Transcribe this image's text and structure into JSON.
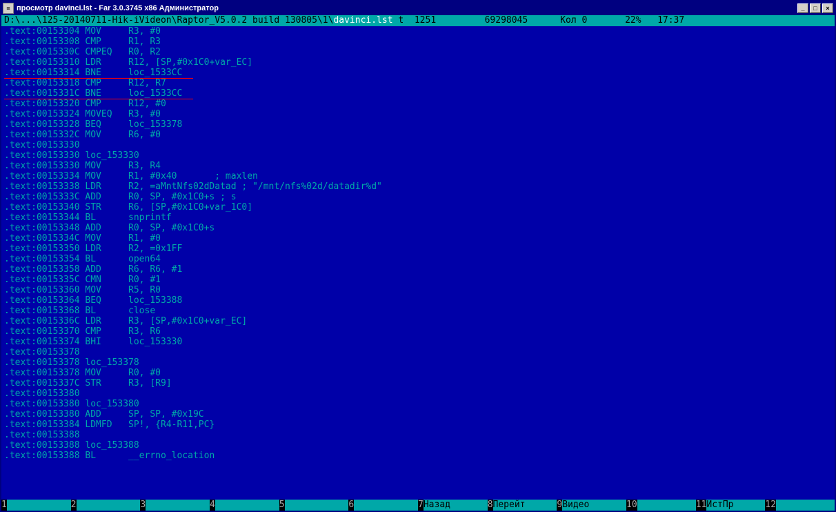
{
  "window": {
    "title": "просмотр davinci.lst - Far 3.0.3745 x86 Администратор"
  },
  "status": {
    "path_prefix": "D:\\...\\125-20140711-Hik-iVideon\\Raptor_V5.0.2 build 130805\\1\\",
    "filename": "davinci.lst",
    "mode": "t",
    "codepage": "1251",
    "size": "69298045",
    "col": "Кол 0",
    "percent": "22%",
    "time": "17:37"
  },
  "code": [
    {
      "addr": ".text:00153304",
      "m": "MOV",
      "o": "R3, #0"
    },
    {
      "addr": ".text:00153308",
      "m": "CMP",
      "o": "R1, R3"
    },
    {
      "addr": ".text:0015330C",
      "m": "CMPEQ",
      "o": "R0, R2"
    },
    {
      "addr": ".text:00153310",
      "m": "LDR",
      "o": "R12, [SP,#0x1C0+var_EC]"
    },
    {
      "addr": ".text:00153314",
      "m": "BNE",
      "o": "loc_1533CC",
      "u": true
    },
    {
      "addr": ".text:00153318",
      "m": "CMP",
      "o": "R12, R7"
    },
    {
      "addr": ".text:0015331C",
      "m": "BNE",
      "o": "loc_1533CC",
      "u": true
    },
    {
      "addr": ".text:00153320",
      "m": "CMP",
      "o": "R12, #0"
    },
    {
      "addr": ".text:00153324",
      "m": "MOVEQ",
      "o": "R3, #0"
    },
    {
      "addr": ".text:00153328",
      "m": "BEQ",
      "o": "loc_153378"
    },
    {
      "addr": ".text:0015332C",
      "m": "MOV",
      "o": "R6, #0"
    },
    {
      "addr": ".text:00153330",
      "m": "",
      "o": ""
    },
    {
      "addr": ".text:00153330",
      "m": "loc_153330",
      "o": "",
      "label": true
    },
    {
      "addr": ".text:00153330",
      "m": "MOV",
      "o": "R3, R4"
    },
    {
      "addr": ".text:00153334",
      "m": "MOV",
      "o": "R1, #0x40       ; maxlen"
    },
    {
      "addr": ".text:00153338",
      "m": "LDR",
      "o": "R2, =aMntNfs02dDatad ; \"/mnt/nfs%02d/datadir%d\""
    },
    {
      "addr": ".text:0015333C",
      "m": "ADD",
      "o": "R0, SP, #0x1C0+s ; s"
    },
    {
      "addr": ".text:00153340",
      "m": "STR",
      "o": "R6, [SP,#0x1C0+var_1C0]"
    },
    {
      "addr": ".text:00153344",
      "m": "BL",
      "o": "snprintf"
    },
    {
      "addr": ".text:00153348",
      "m": "ADD",
      "o": "R0, SP, #0x1C0+s"
    },
    {
      "addr": ".text:0015334C",
      "m": "MOV",
      "o": "R1, #0"
    },
    {
      "addr": ".text:00153350",
      "m": "LDR",
      "o": "R2, =0x1FF"
    },
    {
      "addr": ".text:00153354",
      "m": "BL",
      "o": "open64"
    },
    {
      "addr": ".text:00153358",
      "m": "ADD",
      "o": "R6, R6, #1"
    },
    {
      "addr": ".text:0015335C",
      "m": "CMN",
      "o": "R0, #1"
    },
    {
      "addr": ".text:00153360",
      "m": "MOV",
      "o": "R5, R0"
    },
    {
      "addr": ".text:00153364",
      "m": "BEQ",
      "o": "loc_153388"
    },
    {
      "addr": ".text:00153368",
      "m": "BL",
      "o": "close"
    },
    {
      "addr": ".text:0015336C",
      "m": "LDR",
      "o": "R3, [SP,#0x1C0+var_EC]"
    },
    {
      "addr": ".text:00153370",
      "m": "CMP",
      "o": "R3, R6"
    },
    {
      "addr": ".text:00153374",
      "m": "BHI",
      "o": "loc_153330"
    },
    {
      "addr": ".text:00153378",
      "m": "",
      "o": ""
    },
    {
      "addr": ".text:00153378",
      "m": "loc_153378",
      "o": "",
      "label": true
    },
    {
      "addr": ".text:00153378",
      "m": "MOV",
      "o": "R0, #0"
    },
    {
      "addr": ".text:0015337C",
      "m": "STR",
      "o": "R3, [R9]"
    },
    {
      "addr": ".text:00153380",
      "m": "",
      "o": ""
    },
    {
      "addr": ".text:00153380",
      "m": "loc_153380",
      "o": "",
      "label": true
    },
    {
      "addr": ".text:00153380",
      "m": "ADD",
      "o": "SP, SP, #0x19C"
    },
    {
      "addr": ".text:00153384",
      "m": "LDMFD",
      "o": "SP!, {R4-R11,PC}"
    },
    {
      "addr": ".text:00153388",
      "m": "",
      "o": ""
    },
    {
      "addr": ".text:00153388",
      "m": "loc_153388",
      "o": "",
      "label": true
    },
    {
      "addr": ".text:00153388",
      "m": "BL",
      "o": "__errno_location"
    }
  ],
  "keybar": {
    "items": [
      {
        "n": "1",
        "l": "      "
      },
      {
        "n": "2",
        "l": "      "
      },
      {
        "n": "3",
        "l": "      "
      },
      {
        "n": "4",
        "l": "      "
      },
      {
        "n": "5",
        "l": "      "
      },
      {
        "n": "6",
        "l": "      "
      },
      {
        "n": "7",
        "l": "Назад "
      },
      {
        "n": "8",
        "l": "Перейт"
      },
      {
        "n": "9",
        "l": "Видео "
      },
      {
        "n": "10",
        "l": "      "
      },
      {
        "n": "11",
        "l": "ИстПр "
      },
      {
        "n": "12",
        "l": "      "
      }
    ]
  }
}
